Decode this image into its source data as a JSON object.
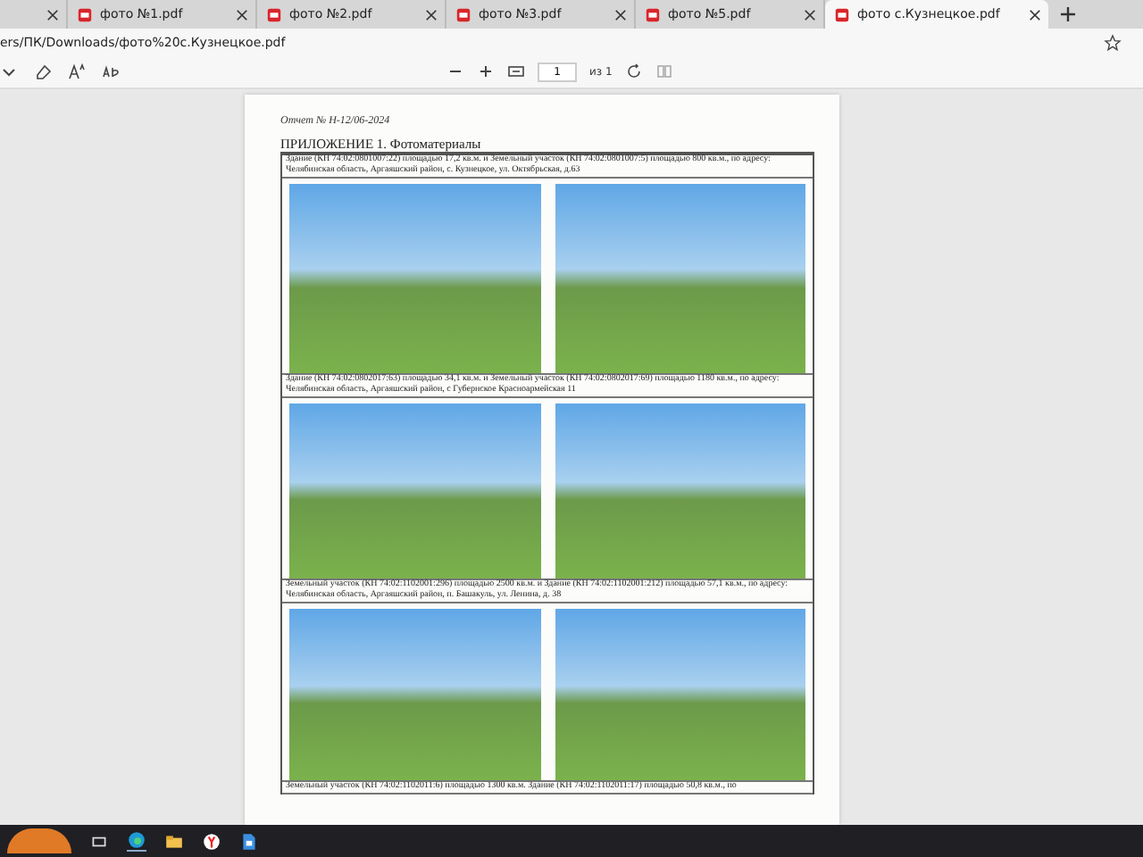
{
  "tabs": [
    {
      "selected": false
    },
    {
      "label": "фото №1.pdf",
      "selected": false
    },
    {
      "label": "фото №2.pdf",
      "selected": false
    },
    {
      "label": "фото №3.pdf",
      "selected": false
    },
    {
      "label": "фото №5.pdf",
      "selected": false
    },
    {
      "label": "фото с.Кузнецкое.pdf",
      "selected": true
    }
  ],
  "address": "ers/ПК/Downloads/фото%20с.Кузнецкое.pdf",
  "toolbar": {
    "page": "1",
    "page_count": "из 1"
  },
  "document": {
    "report": "Отчет № Н-12/06-2024",
    "heading": "ПРИЛОЖЕНИЕ 1. Фотоматериалы",
    "entries": [
      {
        "caption": "Здание (КН 74:02:0801007:22) площадью 17,2 кв.м. и Земельный участок (КН 74:02:0801007:5) площадью 800 кв.м., по адресу: Челябинская область, Аргаяшский район, с. Кузнецкое, ул. Октябрьская, д.63"
      },
      {
        "caption": "Здание (КН 74:02:0802017:63) площадью 34,1 кв.м. и Земельный участок (КН 74:02:0802017:69) площадью 1180 кв.м., по адресу: Челябинская область, Аргаяшский район, с Губернское Красноармейская 11"
      },
      {
        "caption": "Земельный участок (КН 74:02:1102001:296) площадью 2500 кв.м. и Здание (КН 74:02:1102001:212) площадью 57,1 кв.м., по адресу: Челябинская область, Аргаяшский район, п. Башакуль, ул. Ленина, д. 38"
      },
      {
        "caption": "Земельный участок (КН 74:02:1102011:6) площадью 1300 кв.м. Здание (КН 74:02:1102011:17) площадью 50,8 кв.м., по"
      }
    ]
  }
}
